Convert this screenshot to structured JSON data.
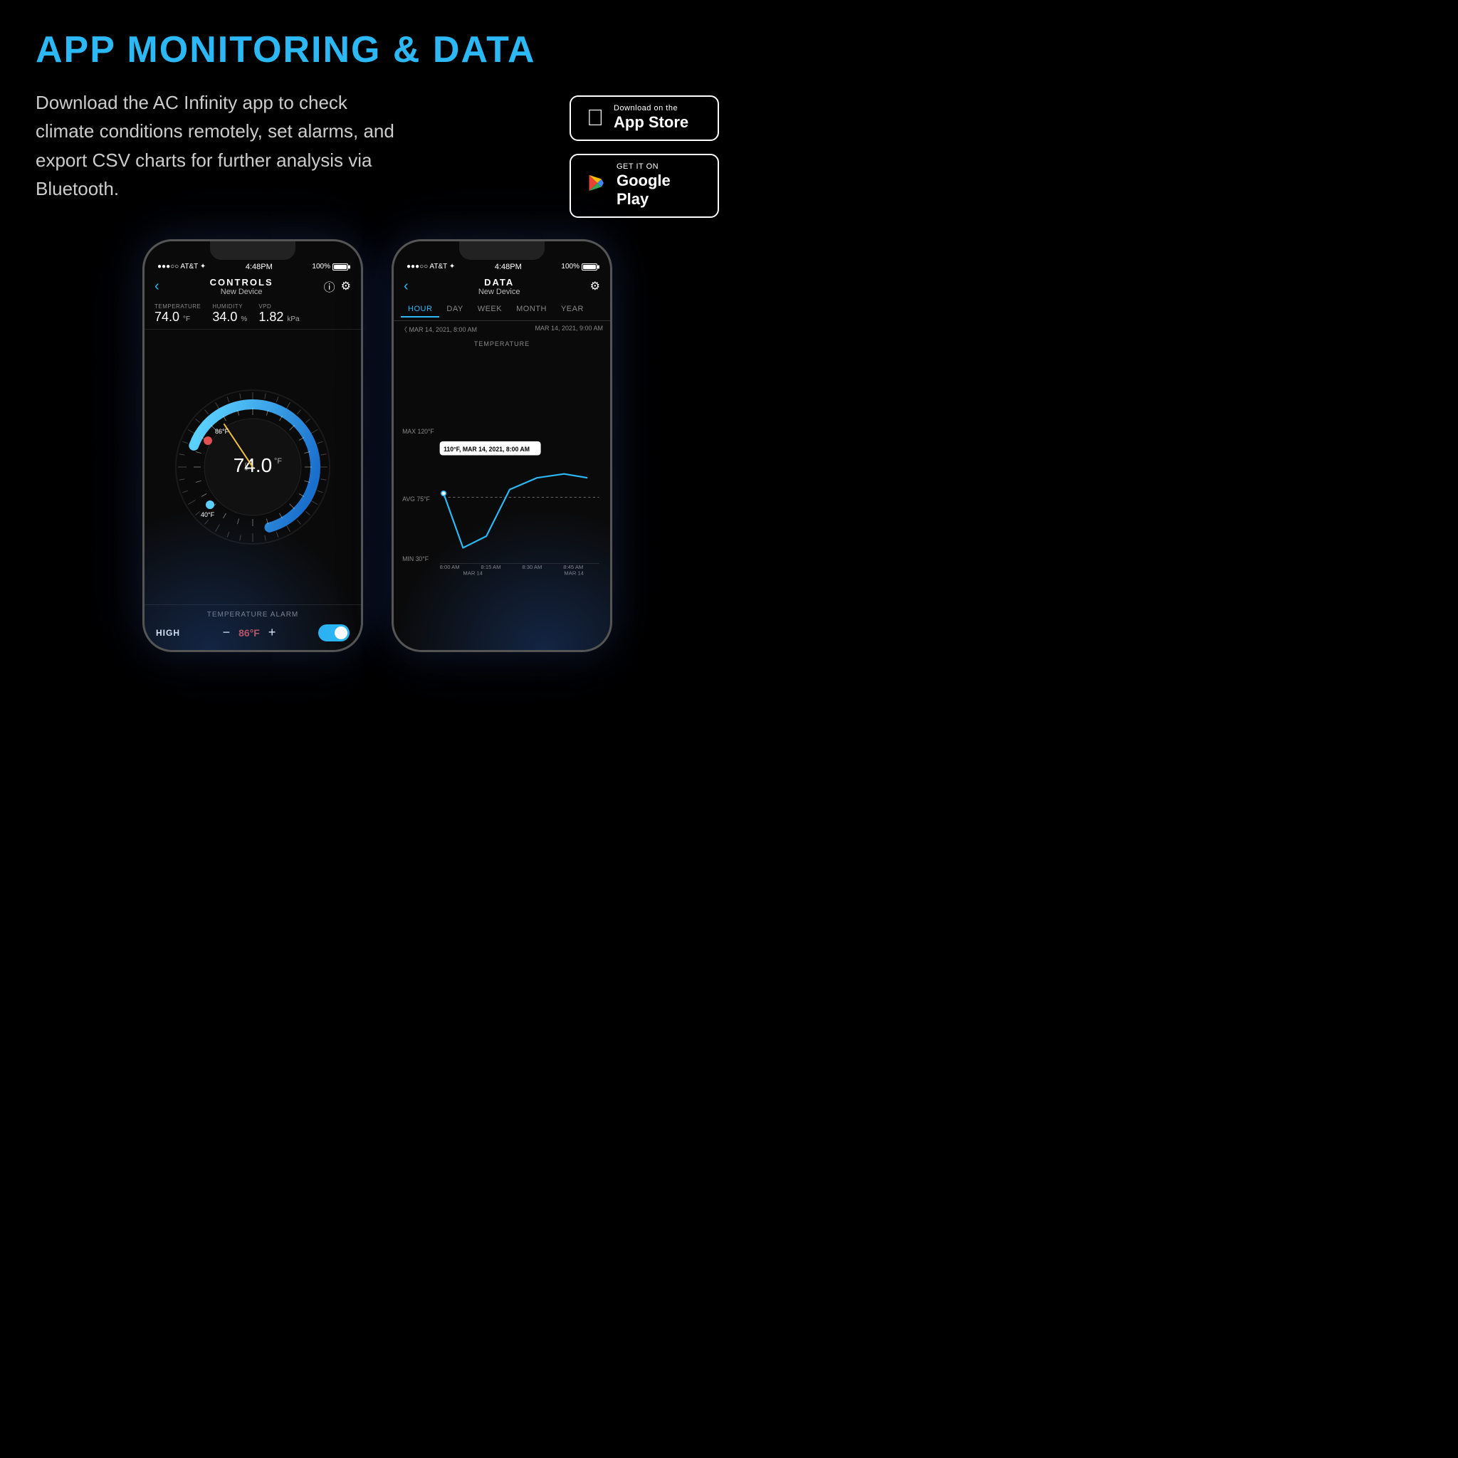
{
  "header": {
    "title": "APP MONITORING & DATA"
  },
  "description": "Download the AC Infinity app to check climate conditions remotely, set alarms, and export CSV charts for further analysis via Bluetooth.",
  "appStore": {
    "sub": "Download on the",
    "main": "App Store"
  },
  "googlePlay": {
    "sub": "GET IT ON",
    "main": "Google Play"
  },
  "leftPhone": {
    "statusBar": {
      "left": "●●●○○  AT&T  ✦",
      "center": "4:48PM",
      "right": "100%"
    },
    "navTitle": "CONTROLS",
    "navDevice": "New Device",
    "metrics": [
      {
        "label": "TEMPERATURE",
        "value": "74.0",
        "unit": "°F"
      },
      {
        "label": "HUMIDITY",
        "value": "34.0",
        "unit": "%"
      },
      {
        "label": "VPD",
        "value": "1.82",
        "unit": "kPa"
      }
    ],
    "gaugeValue": "74.0",
    "gaugeUnit": "°F",
    "alarmTitle": "TEMPERATURE ALARM",
    "alarmLabel": "HIGH",
    "alarmTemp": "86°F"
  },
  "rightPhone": {
    "statusBar": {
      "left": "●●●○○  AT&T  ✦",
      "center": "4:48PM",
      "right": "100%"
    },
    "navTitle": "DATA",
    "navDevice": "New Device",
    "tabs": [
      "HOUR",
      "DAY",
      "WEEK",
      "MONTH",
      "YEAR"
    ],
    "activeTab": "HOUR",
    "dateLeft": "〈  MAR 14, 2021, 8:00 AM",
    "dateRight": "MAR 14, 2021, 9:00 AM",
    "chartLabel": "TEMPERATURE",
    "tooltip": "110°F, MAR 14, 2021, 8:00 AM",
    "yLabels": [
      "MAX 120°F",
      "AVG 75°F",
      "MIN 30°F"
    ],
    "xLabels": [
      "8:00 AM",
      "8:15 AM",
      "8:30 AM",
      "8:45 AM"
    ],
    "dateLabels": [
      "MAR 14",
      "MAR 14"
    ]
  }
}
